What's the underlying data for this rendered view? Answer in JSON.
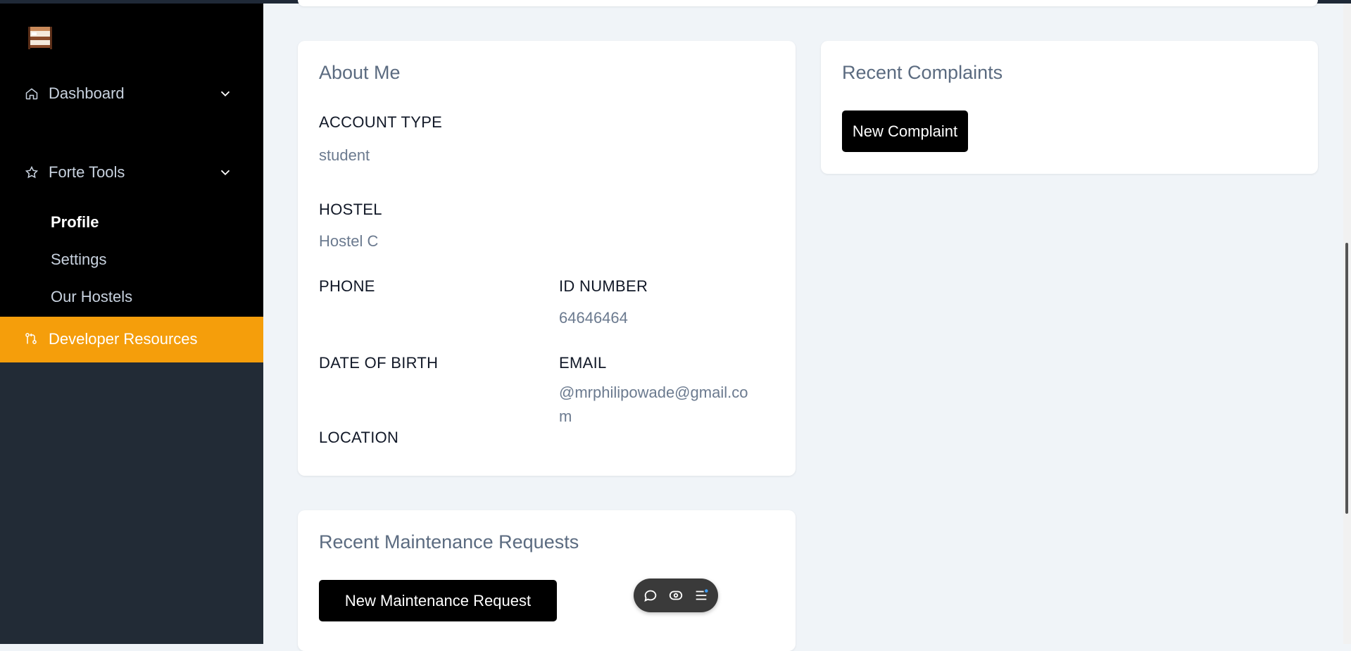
{
  "sidebar": {
    "logo": "hostel-bunkbed-logo",
    "items": [
      {
        "label": "Dashboard",
        "icon": "home-icon"
      },
      {
        "label": "Forte Tools",
        "icon": "star-icon"
      }
    ],
    "sub_items": [
      {
        "label": "Profile",
        "active": true
      },
      {
        "label": "Settings",
        "active": false
      },
      {
        "label": "Our Hostels",
        "active": false
      }
    ],
    "developer": {
      "label": "Developer Resources",
      "icon": "git-pull-request-icon",
      "color": "#f59e0b"
    }
  },
  "about": {
    "title": "About Me",
    "account_type_label": "ACCOUNT TYPE",
    "account_type_value": "student",
    "hostel_label": "HOSTEL",
    "hostel_value": "Hostel C",
    "phone_label": "PHONE",
    "phone_value": "",
    "id_label": "ID NUMBER",
    "id_value": "64646464",
    "dob_label": "DATE OF BIRTH",
    "dob_value": "",
    "email_label": "EMAIL",
    "email_value_line1": "@mrphilipowade@gmail.co",
    "email_value_line2": "m",
    "location_label": "LOCATION",
    "location_value": ""
  },
  "complaints": {
    "title": "Recent Complaints",
    "button": "New Complaint"
  },
  "maintenance": {
    "title": "Recent Maintenance Requests",
    "button": "New Maintenance Request"
  },
  "float_toolbar": {
    "icons": [
      "chat-bubble-icon",
      "eye-toggle-icon",
      "menu-list-icon"
    ]
  }
}
